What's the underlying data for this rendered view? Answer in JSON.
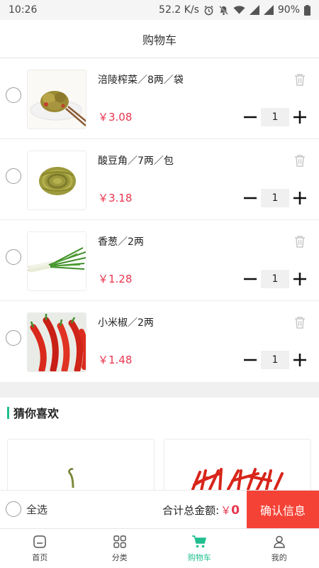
{
  "status_bar": {
    "time": "10:26",
    "net_speed": "52.2 K/s",
    "battery": "90%",
    "icons": [
      "alarm-icon",
      "mute-icon",
      "wifi-icon",
      "signal-icon",
      "signal-icon",
      "battery-icon"
    ]
  },
  "header": {
    "title": "购物车"
  },
  "cart": {
    "items": [
      {
        "name": "涪陵榨菜／8两／袋",
        "price": "￥3.08",
        "qty": "1",
        "image": "pickled-mustard"
      },
      {
        "name": "酸豆角／7两／包",
        "price": "￥3.18",
        "qty": "1",
        "image": "pickled-beans"
      },
      {
        "name": "香葱／2两",
        "price": "￥1.28",
        "qty": "1",
        "image": "scallion"
      },
      {
        "name": "小米椒／2两",
        "price": "￥1.48",
        "qty": "1",
        "image": "red-chili"
      }
    ]
  },
  "recommend": {
    "title": "猜你喜欢"
  },
  "checkout": {
    "select_all": "全选",
    "total_label": "合计总金额:",
    "currency": "￥",
    "total_value": "0",
    "confirm_label": "确认信息"
  },
  "tabbar": {
    "items": [
      {
        "label": "首页",
        "icon": "home-icon",
        "active": false
      },
      {
        "label": "分类",
        "icon": "grid-icon",
        "active": false
      },
      {
        "label": "购物车",
        "icon": "cart-icon",
        "active": true
      },
      {
        "label": "我的",
        "icon": "person-icon",
        "active": false
      }
    ]
  },
  "colors": {
    "accent": "#1fbf8f",
    "price": "#e8364f",
    "confirm": "#f44336"
  }
}
